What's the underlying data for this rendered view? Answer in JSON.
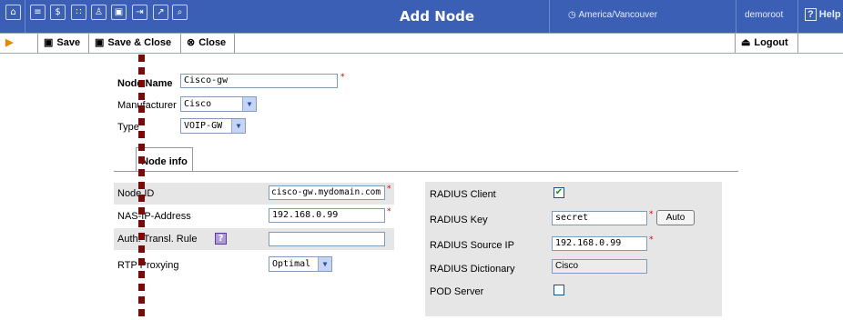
{
  "header": {
    "title": "Add Node",
    "timezone": "America/Vancouver",
    "user": "demoroot",
    "help": "Help",
    "nav_icons": [
      "home-icon",
      "list-icon",
      "dollar-icon",
      "grid-icon",
      "user-icon",
      "node-icon",
      "export-icon",
      "chart-icon",
      "search-doc-icon"
    ]
  },
  "toolbar": {
    "save": "Save",
    "save_close": "Save & Close",
    "close": "Close",
    "logout": "Logout"
  },
  "form": {
    "node_name_label": "Node Name",
    "node_name_value": "Cisco-gw",
    "manufacturer_label": "Manufacturer",
    "manufacturer_value": "Cisco",
    "type_label": "Type",
    "type_value": "VOIP-GW"
  },
  "tabs": [
    {
      "label": "Node info"
    }
  ],
  "left_panel": {
    "node_id_label": "Node ID",
    "node_id_value": "cisco-gw.mydomain.com",
    "nas_ip_label": "NAS-IP-Address",
    "nas_ip_value": "192.168.0.99",
    "auth_rule_label": "Auth. Transl. Rule",
    "auth_rule_value": "",
    "rtp_label": "RTP Proxying",
    "rtp_value": "Optimal"
  },
  "right_panel": {
    "radius_client_label": "RADIUS Client",
    "radius_client_checked": true,
    "radius_key_label": "RADIUS Key",
    "radius_key_value": "secret",
    "auto_button": "Auto",
    "radius_source_ip_label": "RADIUS Source IP",
    "radius_source_ip_value": "192.168.0.99",
    "radius_dictionary_label": "RADIUS Dictionary",
    "radius_dictionary_value": "Cisco",
    "pod_server_label": "POD Server",
    "pod_server_checked": false
  },
  "required_mark": "*",
  "help_mark": "?",
  "colors": {
    "header_bg": "#3b5fb4",
    "panel_bg": "#e6e6e6",
    "required": "#dd0000",
    "dashed_line": "#7a0a0a"
  }
}
